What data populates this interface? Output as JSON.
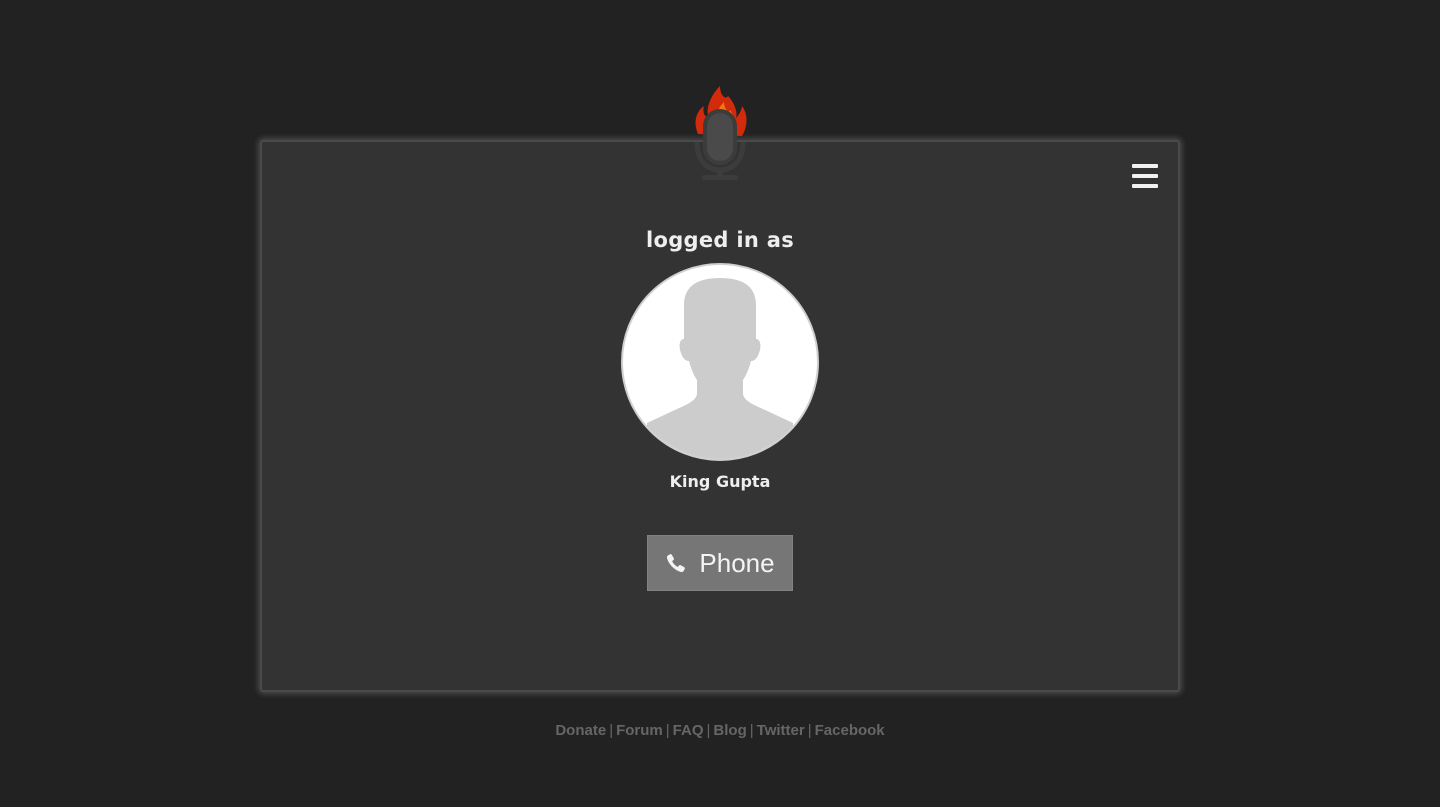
{
  "header": {
    "logo_icon": "flaming-microphone-icon",
    "menu_icon": "hamburger-menu-icon"
  },
  "status": {
    "heading": "logged in as",
    "user_name": "King Gupta",
    "avatar_icon": "default-user-silhouette-icon"
  },
  "actions": {
    "phone_label": "Phone",
    "phone_icon": "phone-handset-icon"
  },
  "footer": {
    "links": [
      "Donate",
      "Forum",
      "FAQ",
      "Blog",
      "Twitter",
      "Facebook"
    ],
    "separator": "|"
  },
  "colors": {
    "page_background": "#222222",
    "card_background": "#333333",
    "button_background": "#767676",
    "flame_red": "#d42a0c",
    "flame_orange": "#f07a12",
    "footer_text": "#666666"
  }
}
